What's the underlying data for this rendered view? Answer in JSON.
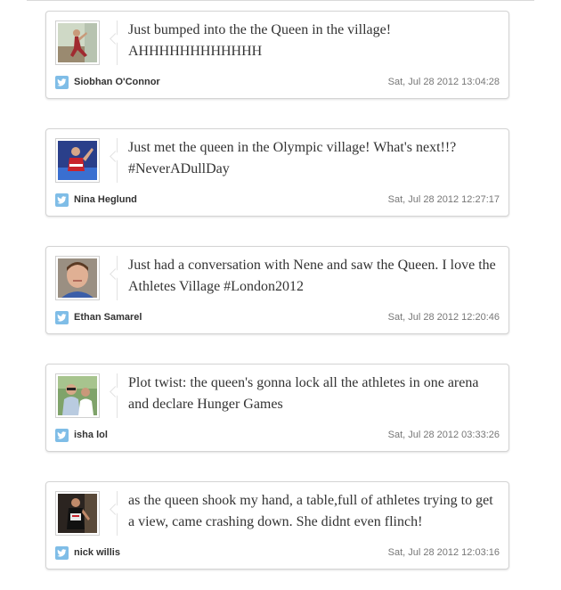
{
  "tweets": [
    {
      "text": "Just bumped into the the Queen in the village! AHHHHHHHHHHHH",
      "author": "Siobhan O'Connor",
      "timestamp": "Sat, Jul 28 2012 13:04:28"
    },
    {
      "text": "Just met the queen in the Olympic village! What's next!!? #NeverADullDay",
      "author": "Nina Heglund",
      "timestamp": "Sat, Jul 28 2012 12:27:17"
    },
    {
      "text": "Just had a conversation with Nene and saw the Queen. I love the Athletes Village #London2012",
      "author": "Ethan Samarel",
      "timestamp": "Sat, Jul 28 2012 12:20:46"
    },
    {
      "text": "Plot twist: the queen's gonna lock all the athletes in one arena and declare Hunger Games",
      "author": "isha lol",
      "timestamp": "Sat, Jul 28 2012 03:33:26"
    },
    {
      "text": "as the queen shook my hand, a table,full of athletes trying to get a view, came crashing down. She didnt even flinch!",
      "author": "nick willis",
      "timestamp": "Sat, Jul 28 2012 12:03:16"
    }
  ]
}
